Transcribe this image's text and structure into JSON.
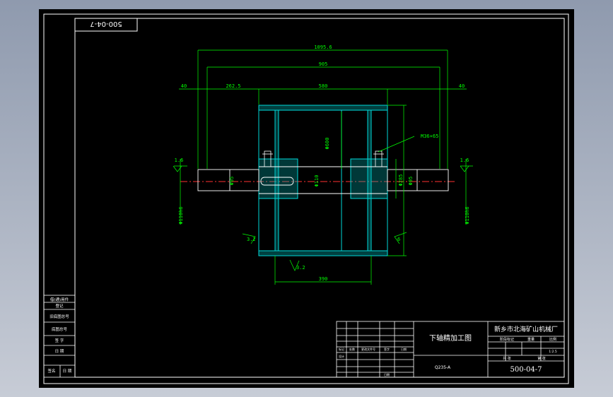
{
  "drawing": {
    "code_rotated": "500-04-7",
    "dims": {
      "overall": "1095.6",
      "span": "905",
      "left_end": "40",
      "left_len": "262.5",
      "drum_len": "580",
      "right_end": "40",
      "drum_dia": "Φ600",
      "weld": "6",
      "hub_dia": "Φ285",
      "bore_key": "M36×65",
      "shaft_left": "Φ95",
      "shaft_mid": "Φ110",
      "shaft_right": "Φ95",
      "hub_len": "390",
      "tol_left": "1.6",
      "tol_right": "1.6",
      "bear_left": "Φ110h6",
      "bear_right": "Φ110h6",
      "weld_left": "3.2",
      "weld_right": "6",
      "rough_bottom": "3.2"
    }
  },
  "title_block": {
    "drawing_name": "下轴精加工图",
    "material": "Q235-A",
    "company": "新乡市北海矿山机械厂",
    "code": "500-04-7",
    "col_headers": [
      "阶段标记",
      "重量",
      "比例"
    ],
    "scale": "1:2.5",
    "share": "共 张",
    "sheet": "第 张",
    "rev_headers": [
      "标记",
      "处数",
      "更改文件号",
      "签字",
      "日期"
    ],
    "designer": "设计",
    "approve": "日期"
  },
  "left_block": [
    "借(通)用件",
    "登记",
    "旧底图总号",
    "底图总号",
    "签 字",
    "日 期",
    "签名",
    "日 期"
  ]
}
